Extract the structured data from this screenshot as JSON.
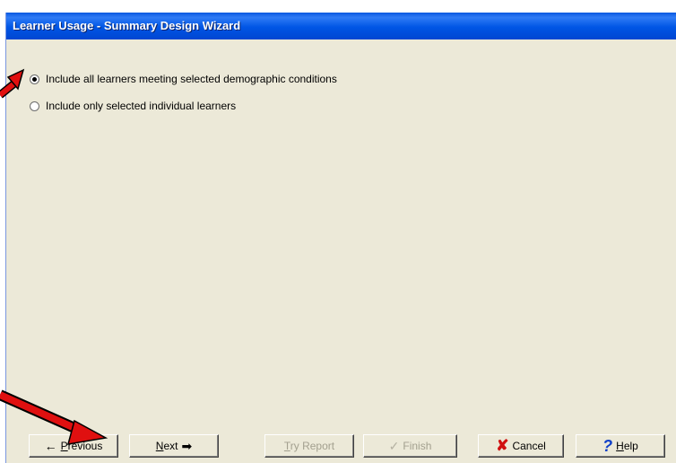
{
  "window": {
    "title": "Learner Usage - Summary Design Wizard"
  },
  "options": [
    {
      "label": "Include all learners meeting selected demographic conditions",
      "checked": true
    },
    {
      "label": "Include only selected individual learners",
      "checked": false
    }
  ],
  "buttons": {
    "previous": {
      "arrow": "←",
      "mnemonic": "P",
      "rest": "revious"
    },
    "next": {
      "mnemonic": "N",
      "rest": "ext",
      "arrow": "➡"
    },
    "try_report": {
      "mnemonic": "T",
      "rest": "ry Report",
      "enabled": false
    },
    "finish": {
      "label": "Finish",
      "enabled": false
    },
    "cancel": {
      "icon": "✘",
      "label": "Cancel"
    },
    "help": {
      "icon": "?",
      "mnemonic": "H",
      "rest": "elp"
    }
  },
  "colors": {
    "title_bar": "#0055e5",
    "dialog_face": "#ECE9D8",
    "annotation_arrow": "#e01010"
  },
  "icons": [
    "left-arrow-icon",
    "right-arrow-icon",
    "checkmark-icon",
    "red-x-icon",
    "help-question-icon"
  ]
}
